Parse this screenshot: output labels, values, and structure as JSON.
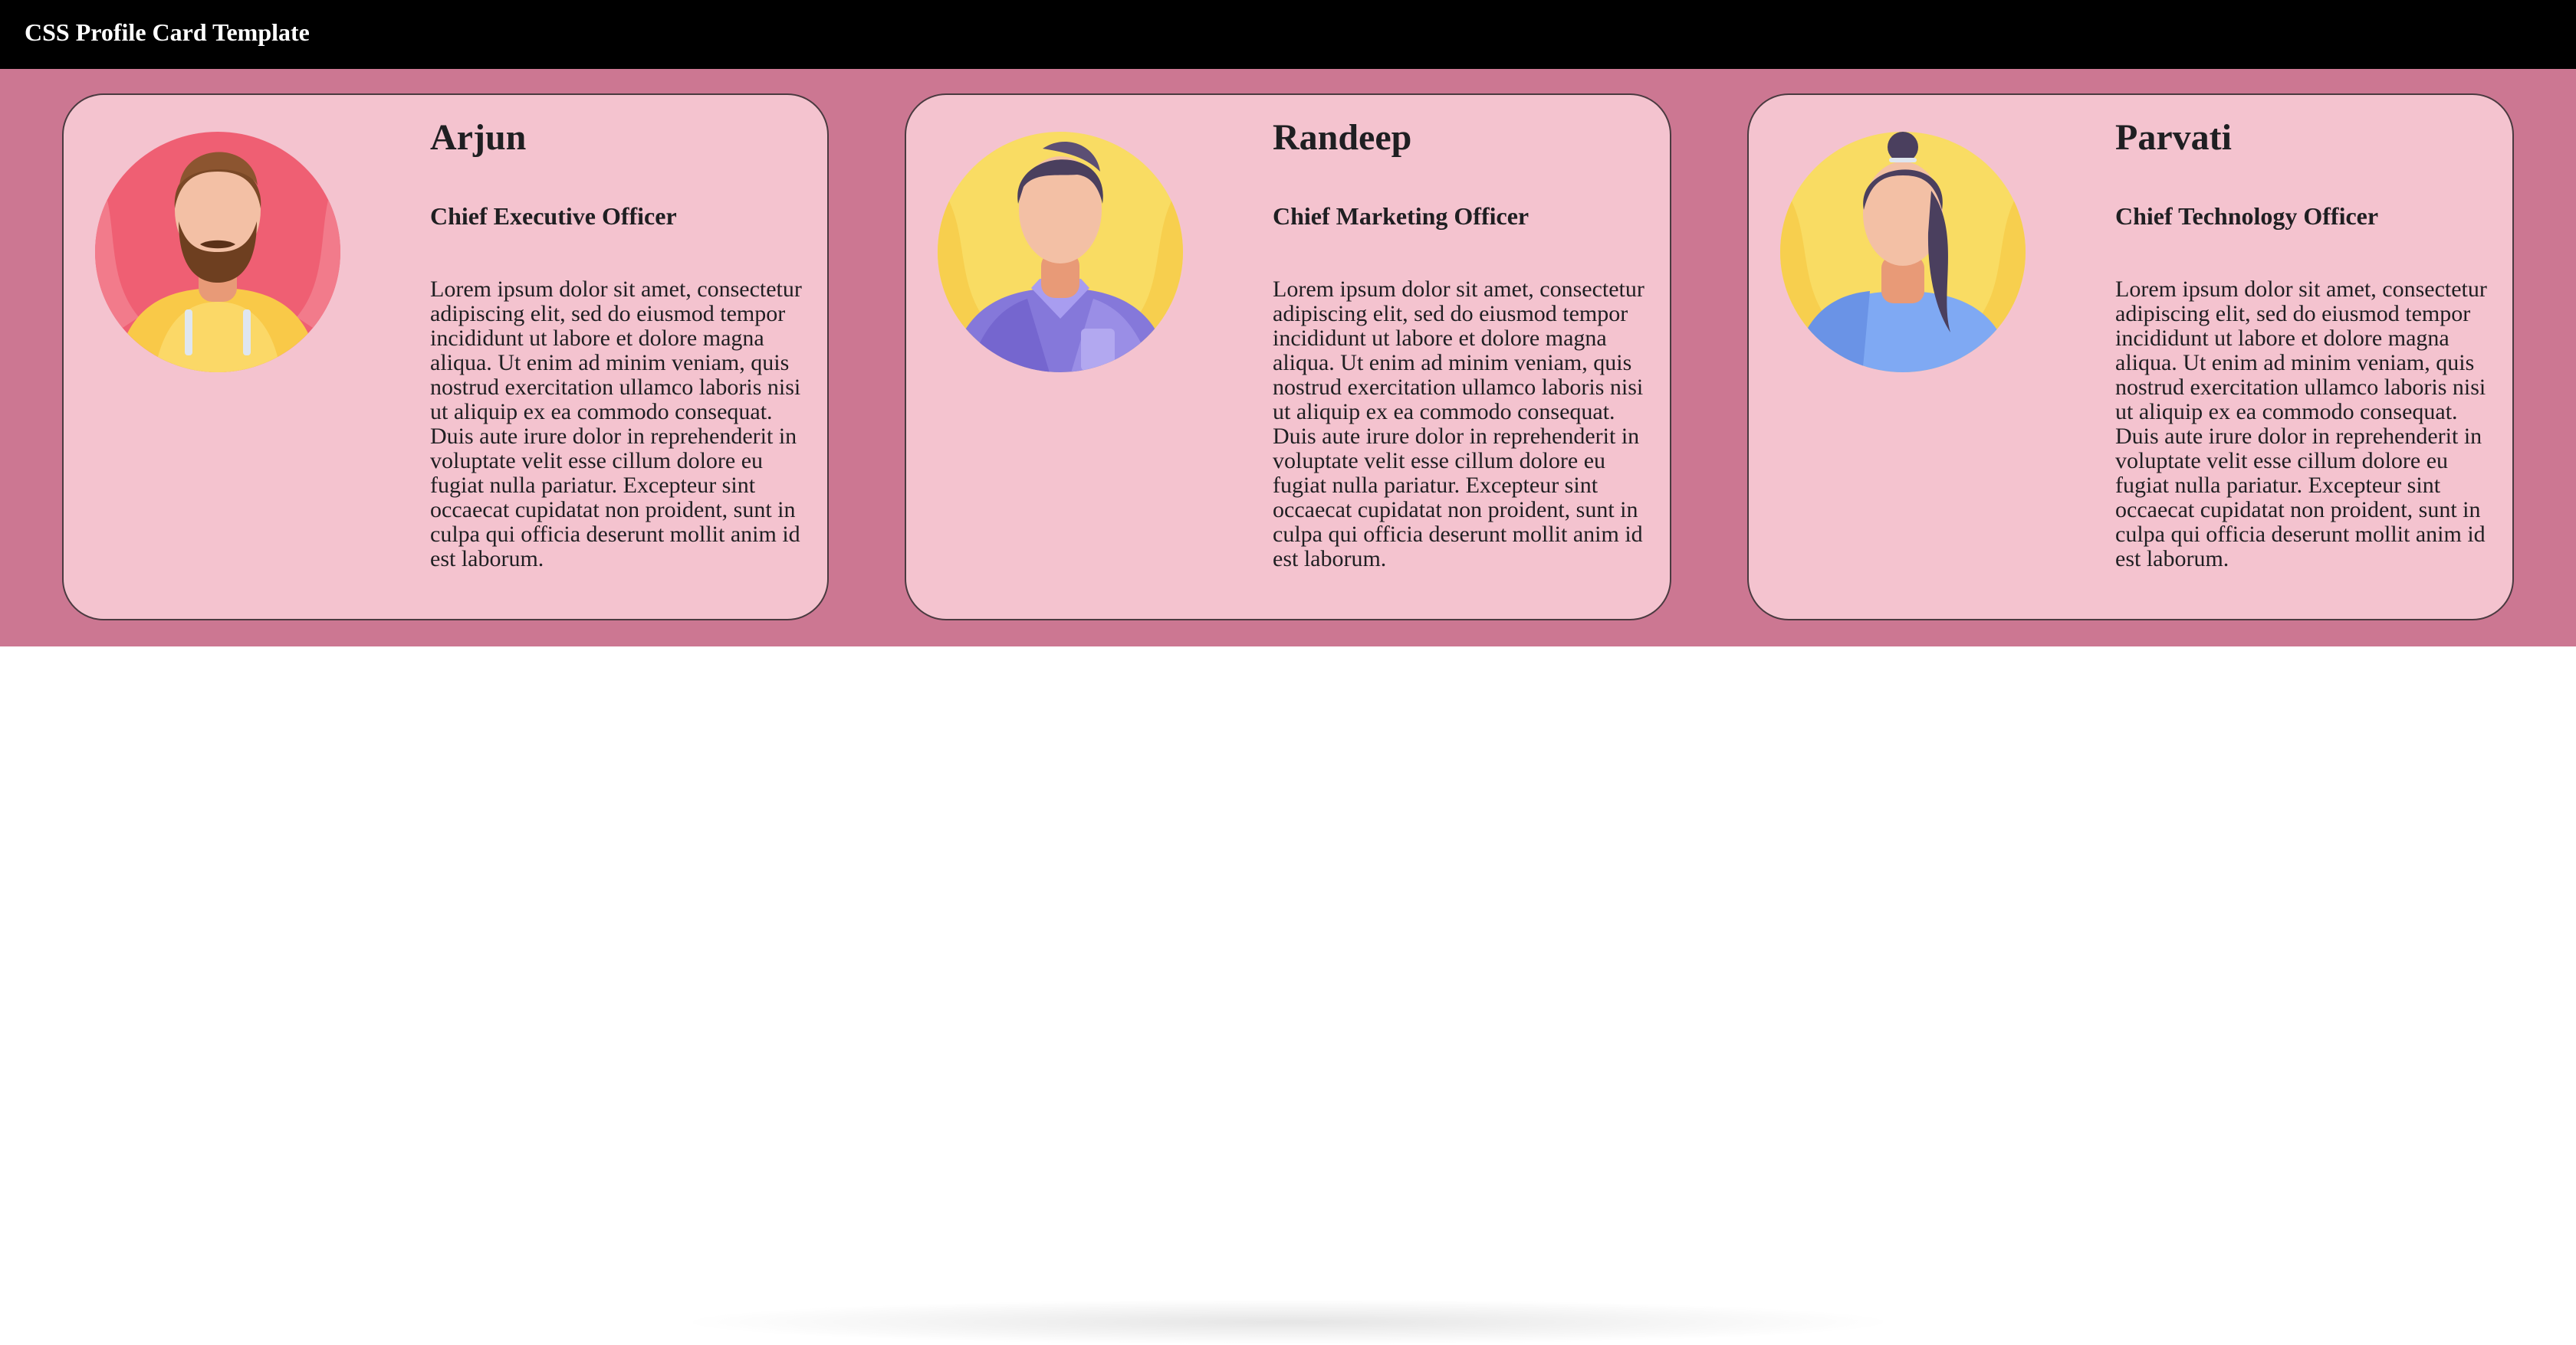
{
  "page": {
    "title": "CSS Profile Card Template"
  },
  "colors": {
    "topbar": "#000000",
    "band": "#cc7792",
    "card": "#f4c3cf",
    "text": "#1f1f22"
  },
  "profiles": [
    {
      "name": "Arjun",
      "role": "Chief Executive Officer",
      "avatar_icon": "bearded-man-yellow-hoodie-avatar",
      "bio": "Lorem ipsum dolor sit amet, consectetur adipiscing elit, sed do eiusmod tempor incididunt ut labore et dolore magna aliqua. Ut enim ad minim veniam, quis nostrud exercitation ullamco laboris nisi ut aliquip ex ea commodo consequat. Duis aute irure dolor in reprehenderit in voluptate velit esse cillum dolore eu fugiat nulla pariatur. Excepteur sint occaecat cupidatat non proident, sunt in culpa qui officia deserunt mollit anim id est laborum."
    },
    {
      "name": "Randeep",
      "role": "Chief Marketing Officer",
      "avatar_icon": "man-purple-shirt-avatar",
      "bio": "Lorem ipsum dolor sit amet, consectetur adipiscing elit, sed do eiusmod tempor incididunt ut labore et dolore magna aliqua. Ut enim ad minim veniam, quis nostrud exercitation ullamco laboris nisi ut aliquip ex ea commodo consequat. Duis aute irure dolor in reprehenderit in voluptate velit esse cillum dolore eu fugiat nulla pariatur. Excepteur sint occaecat cupidatat non proident, sunt in culpa qui officia deserunt mollit anim id est laborum."
    },
    {
      "name": "Parvati",
      "role": "Chief Technology Officer",
      "avatar_icon": "woman-ponytail-blue-top-avatar",
      "bio": "Lorem ipsum dolor sit amet, consectetur adipiscing elit, sed do eiusmod tempor incididunt ut labore et dolore magna aliqua. Ut enim ad minim veniam, quis nostrud exercitation ullamco laboris nisi ut aliquip ex ea commodo consequat. Duis aute irure dolor in reprehenderit in voluptate velit esse cillum dolore eu fugiat nulla pariatur. Excepteur sint occaecat cupidatat non proident, sunt in culpa qui officia deserunt mollit anim id est laborum."
    }
  ]
}
